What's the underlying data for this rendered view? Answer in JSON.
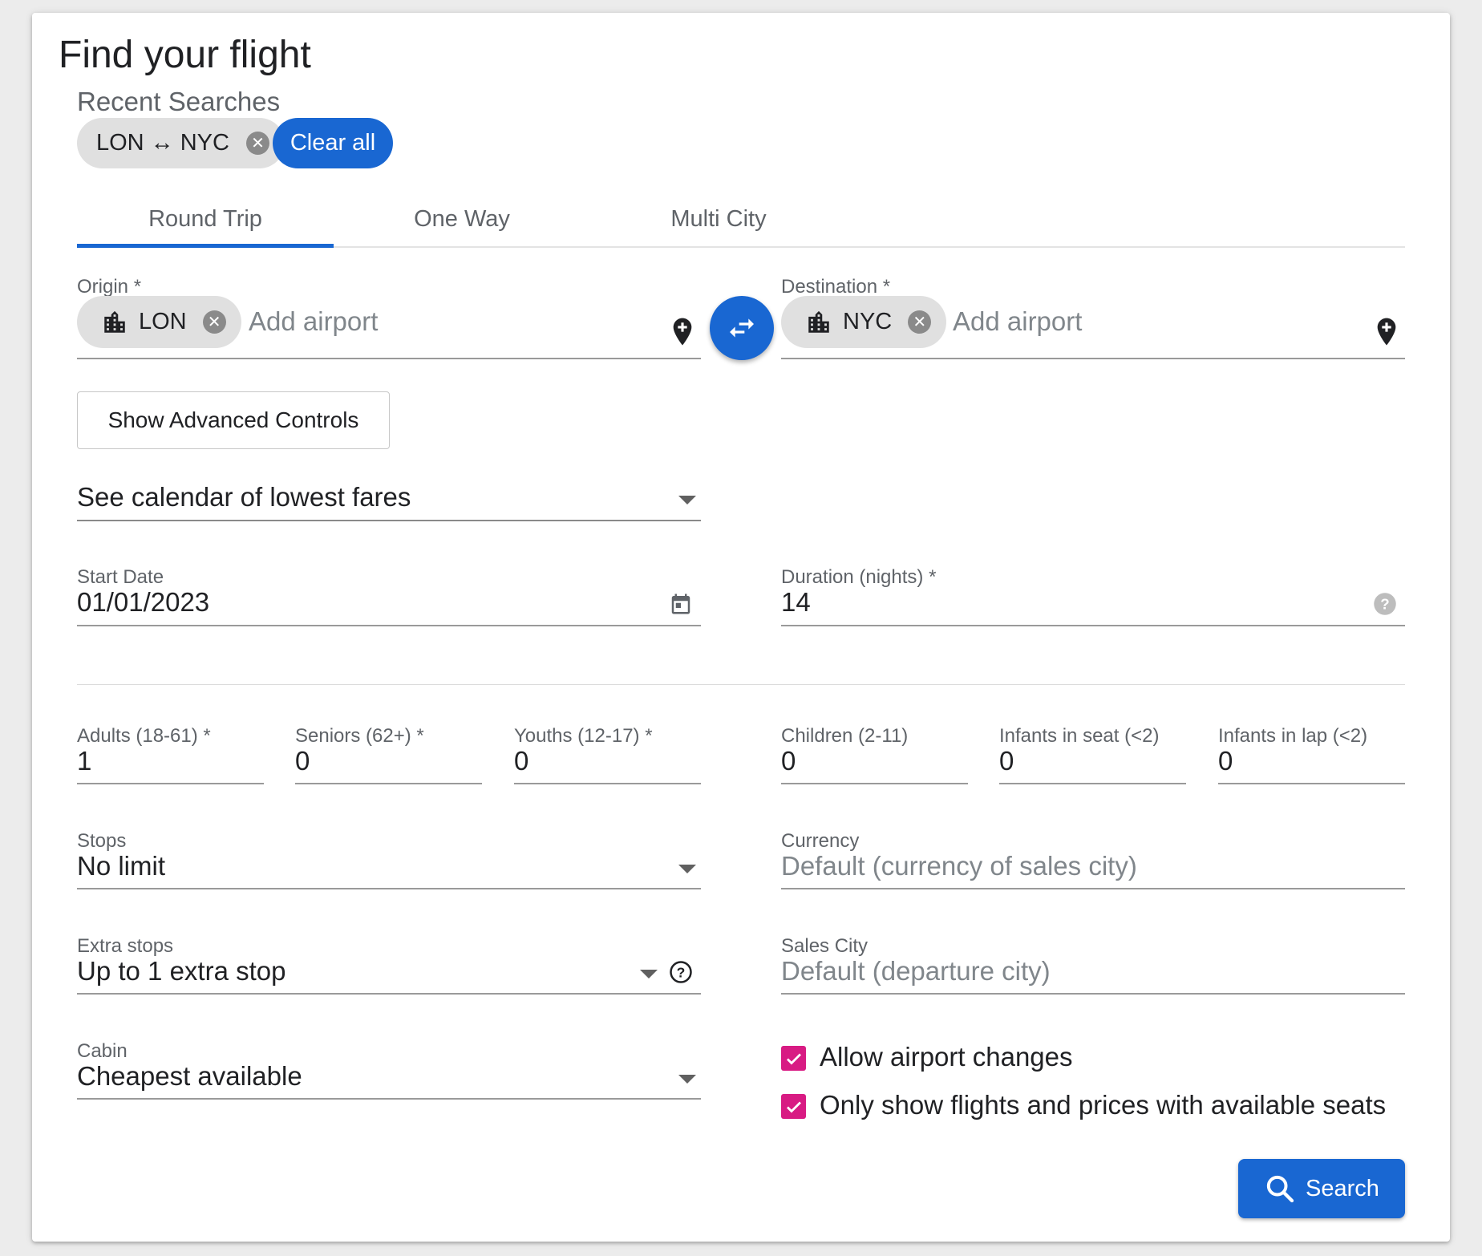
{
  "header": {
    "title": "Find your flight"
  },
  "recent": {
    "label": "Recent Searches",
    "chips": [
      {
        "label": "LON ↔ NYC"
      }
    ],
    "clear_label": "Clear all"
  },
  "tabs": [
    {
      "label": "Round Trip",
      "selected": true
    },
    {
      "label": "One Way",
      "selected": false
    },
    {
      "label": "Multi City",
      "selected": false
    }
  ],
  "origin": {
    "label": "Origin *",
    "chip": "LON",
    "placeholder": "Add airport"
  },
  "destination": {
    "label": "Destination *",
    "chip": "NYC",
    "placeholder": "Add airport"
  },
  "advanced_button": "Show Advanced Controls",
  "calendar_select": {
    "value": "See calendar of lowest fares"
  },
  "start_date": {
    "label": "Start Date",
    "value": "01/01/2023"
  },
  "duration": {
    "label": "Duration (nights) *",
    "value": "14"
  },
  "passengers": [
    {
      "label": "Adults (18-61) *",
      "value": "1"
    },
    {
      "label": "Seniors (62+) *",
      "value": "0"
    },
    {
      "label": "Youths (12-17) *",
      "value": "0"
    },
    {
      "label": "Children (2-11)",
      "value": "0"
    },
    {
      "label": "Infants in seat (<2)",
      "value": "0"
    },
    {
      "label": "Infants in lap (<2)",
      "value": "0"
    }
  ],
  "stops": {
    "label": "Stops",
    "value": "No limit"
  },
  "currency": {
    "label": "Currency",
    "placeholder": "Default (currency of sales city)"
  },
  "extra_stops": {
    "label": "Extra stops",
    "value": "Up to 1 extra stop"
  },
  "sales_city": {
    "label": "Sales City",
    "placeholder": "Default (departure city)"
  },
  "cabin": {
    "label": "Cabin",
    "value": "Cheapest available"
  },
  "checkboxes": [
    {
      "label": "Allow airport changes",
      "checked": true
    },
    {
      "label": "Only show flights and prices with available seats",
      "checked": true
    }
  ],
  "search_button": "Search",
  "colors": {
    "primary": "#1967d2",
    "checkbox": "#d81b83",
    "chip": "#e0e0e0"
  },
  "icons": [
    "cancel-icon",
    "city-icon",
    "add-location-icon",
    "swap-icon",
    "calendar-icon",
    "help-icon",
    "dropdown-arrow-icon",
    "check-icon",
    "search-icon"
  ]
}
